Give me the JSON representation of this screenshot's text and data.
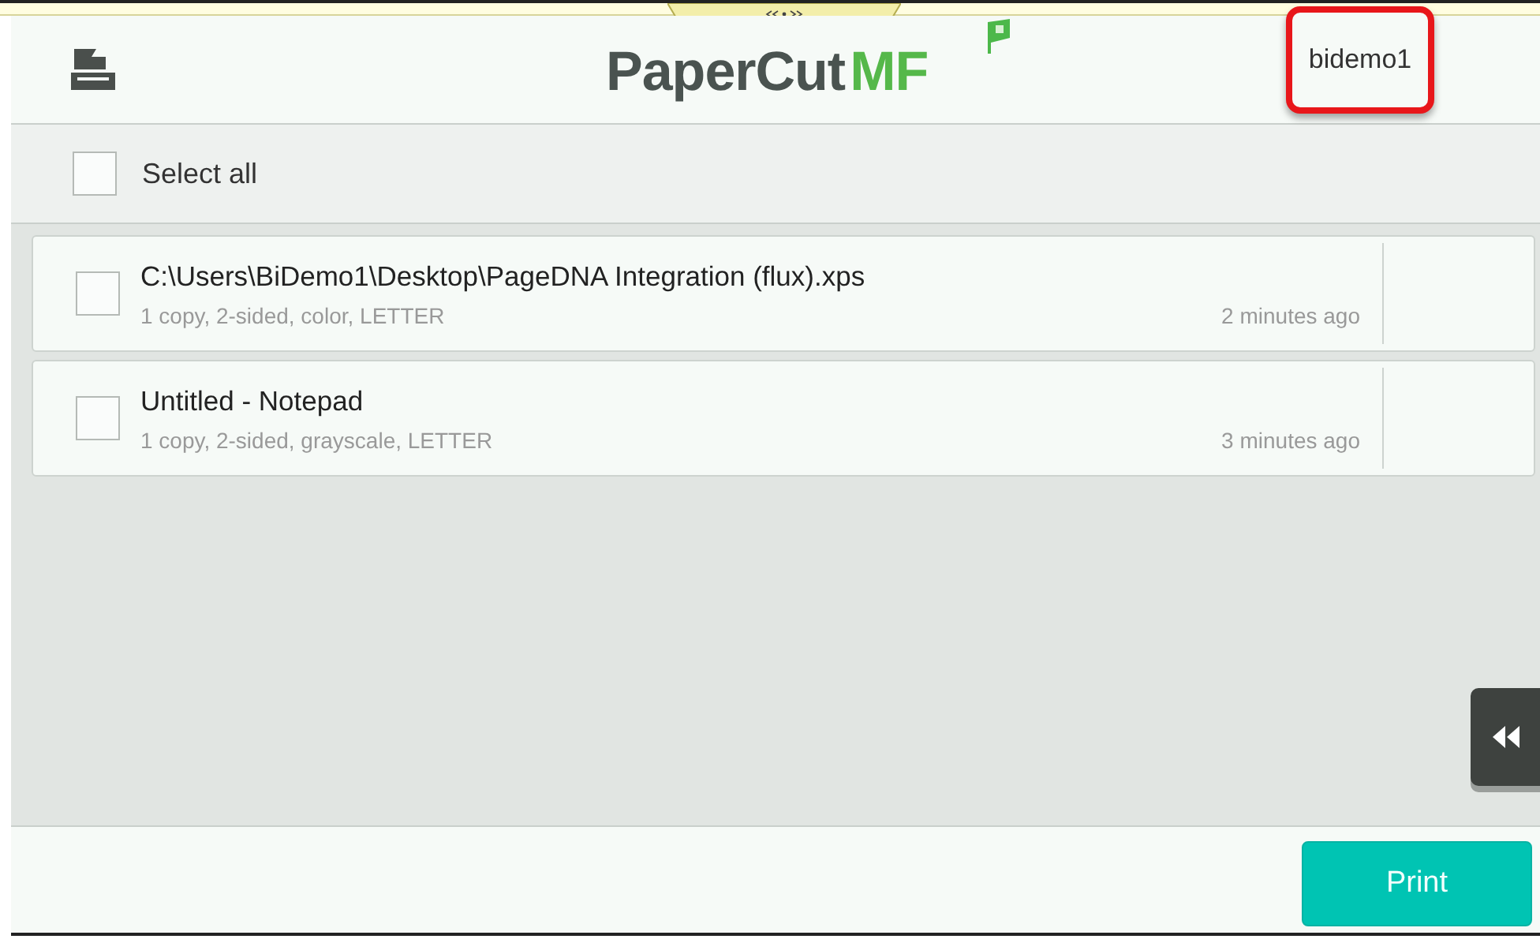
{
  "header": {
    "logo": {
      "name": "PaperCut",
      "suffix": "MF"
    },
    "user": "bidemo1"
  },
  "select_all": {
    "label": "Select all",
    "checked": false
  },
  "jobs": [
    {
      "name": "C:\\Users\\BiDemo1\\Desktop\\PageDNA Integration (flux).xps",
      "details": "1 copy, 2-sided, color, LETTER",
      "time": "2 minutes ago",
      "checked": false
    },
    {
      "name": "Untitled - Notepad",
      "details": "1 copy, 2-sided, grayscale, LETTER",
      "time": "3 minutes ago",
      "checked": false
    }
  ],
  "footer": {
    "button": "Print"
  }
}
